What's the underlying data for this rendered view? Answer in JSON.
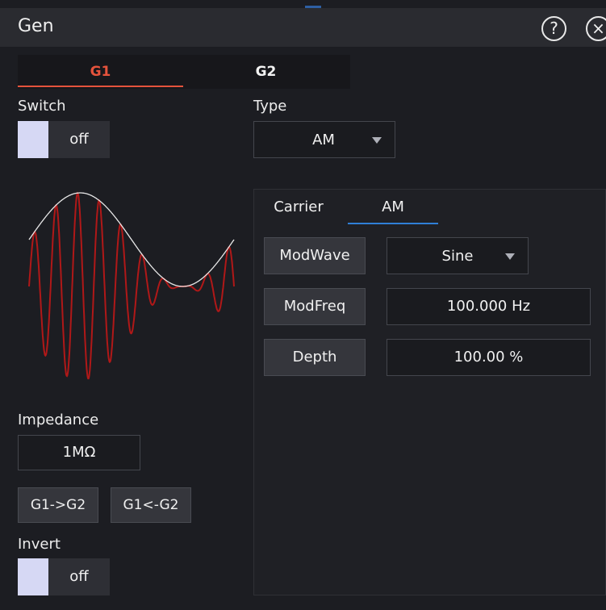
{
  "window": {
    "title": "Gen"
  },
  "header": {
    "help_icon_glyph": "?",
    "close_icon_glyph": "×"
  },
  "tabs": [
    {
      "label": "G1",
      "active": true
    },
    {
      "label": "G2",
      "active": false
    }
  ],
  "left": {
    "switch_label": "Switch",
    "switch_value": "off",
    "impedance_label": "Impedance",
    "impedance_value": "1MΩ",
    "copy_to_g2": "G1->G2",
    "copy_from_g2": "G1<-G2",
    "invert_label": "Invert",
    "invert_value": "off"
  },
  "type": {
    "label": "Type",
    "value": "AM"
  },
  "subtabs": [
    {
      "label": "Carrier",
      "active": false
    },
    {
      "label": "AM",
      "active": true
    }
  ],
  "am": {
    "modwave_label": "ModWave",
    "modwave_value": "Sine",
    "modfreq_label": "ModFreq",
    "modfreq_value": "100.000 Hz",
    "depth_label": "Depth",
    "depth_value": "100.00 %"
  },
  "colors": {
    "accent_g1": "#e5533c",
    "accent_blue": "#2f7fd6",
    "waveform_carrier": "#b01818",
    "waveform_envelope": "#e8e8e8",
    "toggle_knob": "#d6d8f4"
  },
  "icons": {
    "help": "question-circle-icon",
    "close": "close-circle-icon",
    "dropdown": "caret-down-icon"
  }
}
